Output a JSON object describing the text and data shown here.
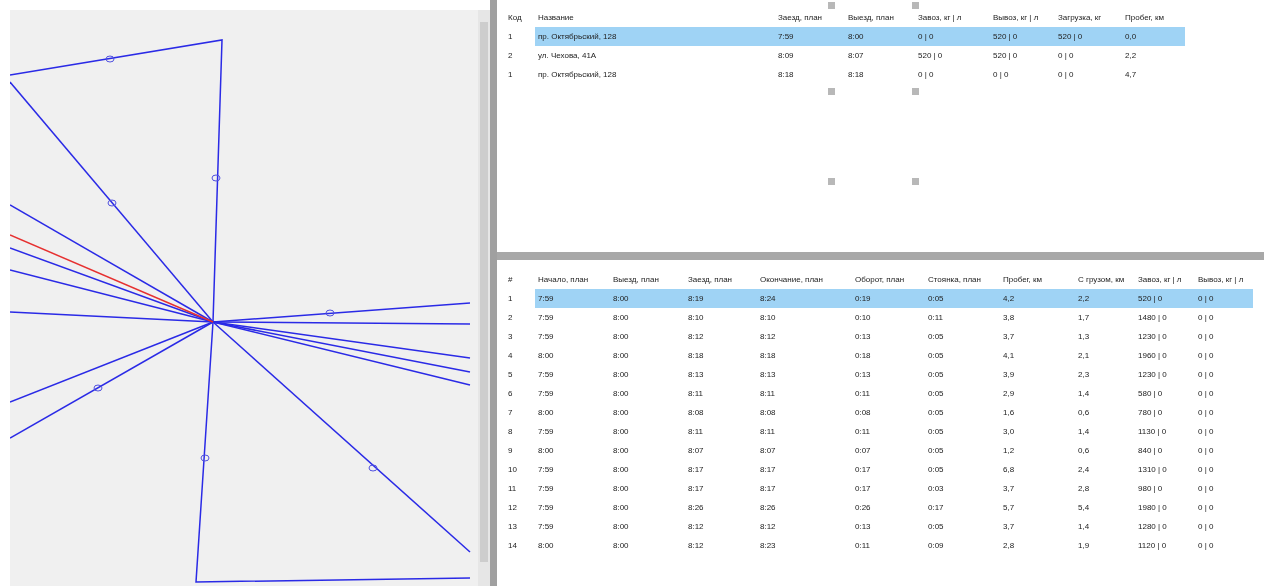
{
  "map": {
    "kind": "route-map"
  },
  "points_table": {
    "columns": [
      "Код",
      "Название",
      "Заезд, план",
      "Выезд, план",
      "Завоз, кг | л",
      "Вывоз, кг | л",
      "Загрузка, кг",
      "Пробег, км"
    ],
    "rows": [
      {
        "selected": true,
        "cells": [
          "1",
          "пр. Октябрьский, 128",
          "7:59",
          "8:00",
          "0 | 0",
          "520 | 0",
          "520 | 0",
          "0,0"
        ]
      },
      {
        "selected": false,
        "cells": [
          "2",
          "ул. Чехова, 41А",
          "8:09",
          "8:07",
          "520 | 0",
          "520 | 0",
          "0 | 0",
          "2,2"
        ]
      },
      {
        "selected": false,
        "cells": [
          "1",
          "пр. Октябрьский, 128",
          "8:18",
          "8:18",
          "0 | 0",
          "0 | 0",
          "0 | 0",
          "4,7"
        ]
      }
    ]
  },
  "trips_table": {
    "columns": [
      "#",
      "Начало, план",
      "Выезд, план",
      "Заезд, план",
      "Окончание, план",
      "Оборот, план",
      "Стоянка, план",
      "Пробег, км",
      "С грузом, км",
      "Завоз, кг | л",
      "Вывоз, кг | л"
    ],
    "rows": [
      {
        "selected": true,
        "cells": [
          "1",
          "7:59",
          "8:00",
          "8:19",
          "8:24",
          "0:19",
          "0:05",
          "4,2",
          "2,2",
          "520 | 0",
          "0 | 0"
        ]
      },
      {
        "selected": false,
        "cells": [
          "2",
          "7:59",
          "8:00",
          "8:10",
          "8:10",
          "0:10",
          "0:11",
          "3,8",
          "1,7",
          "1480 | 0",
          "0 | 0"
        ]
      },
      {
        "selected": false,
        "cells": [
          "3",
          "7:59",
          "8:00",
          "8:12",
          "8:12",
          "0:13",
          "0:05",
          "3,7",
          "1,3",
          "1230 | 0",
          "0 | 0"
        ]
      },
      {
        "selected": false,
        "cells": [
          "4",
          "8:00",
          "8:00",
          "8:18",
          "8:18",
          "0:18",
          "0:05",
          "4,1",
          "2,1",
          "1960 | 0",
          "0 | 0"
        ]
      },
      {
        "selected": false,
        "cells": [
          "5",
          "7:59",
          "8:00",
          "8:13",
          "8:13",
          "0:13",
          "0:05",
          "3,9",
          "2,3",
          "1230 | 0",
          "0 | 0"
        ]
      },
      {
        "selected": false,
        "cells": [
          "6",
          "7:59",
          "8:00",
          "8:11",
          "8:11",
          "0:11",
          "0:05",
          "2,9",
          "1,4",
          "580 | 0",
          "0 | 0"
        ]
      },
      {
        "selected": false,
        "cells": [
          "7",
          "8:00",
          "8:00",
          "8:08",
          "8:08",
          "0:08",
          "0:05",
          "1,6",
          "0,6",
          "780 | 0",
          "0 | 0"
        ]
      },
      {
        "selected": false,
        "cells": [
          "8",
          "7:59",
          "8:00",
          "8:11",
          "8:11",
          "0:11",
          "0:05",
          "3,0",
          "1,4",
          "1130 | 0",
          "0 | 0"
        ]
      },
      {
        "selected": false,
        "cells": [
          "9",
          "8:00",
          "8:00",
          "8:07",
          "8:07",
          "0:07",
          "0:05",
          "1,2",
          "0,6",
          "840 | 0",
          "0 | 0"
        ]
      },
      {
        "selected": false,
        "cells": [
          "10",
          "7:59",
          "8:00",
          "8:17",
          "8:17",
          "0:17",
          "0:05",
          "6,8",
          "2,4",
          "1310 | 0",
          "0 | 0"
        ]
      },
      {
        "selected": false,
        "cells": [
          "11",
          "7:59",
          "8:00",
          "8:17",
          "8:17",
          "0:17",
          "0:03",
          "3,7",
          "2,8",
          "980 | 0",
          "0 | 0"
        ]
      },
      {
        "selected": false,
        "cells": [
          "12",
          "7:59",
          "8:00",
          "8:26",
          "8:26",
          "0:26",
          "0:17",
          "5,7",
          "5,4",
          "1980 | 0",
          "0 | 0"
        ]
      },
      {
        "selected": false,
        "cells": [
          "13",
          "7:59",
          "8:00",
          "8:12",
          "8:12",
          "0:13",
          "0:05",
          "3,7",
          "1,4",
          "1280 | 0",
          "0 | 0"
        ]
      },
      {
        "selected": false,
        "cells": [
          "14",
          "8:00",
          "8:00",
          "8:12",
          "8:23",
          "0:11",
          "0:09",
          "2,8",
          "1,9",
          "1120 | 0",
          "0 | 0"
        ]
      }
    ]
  }
}
